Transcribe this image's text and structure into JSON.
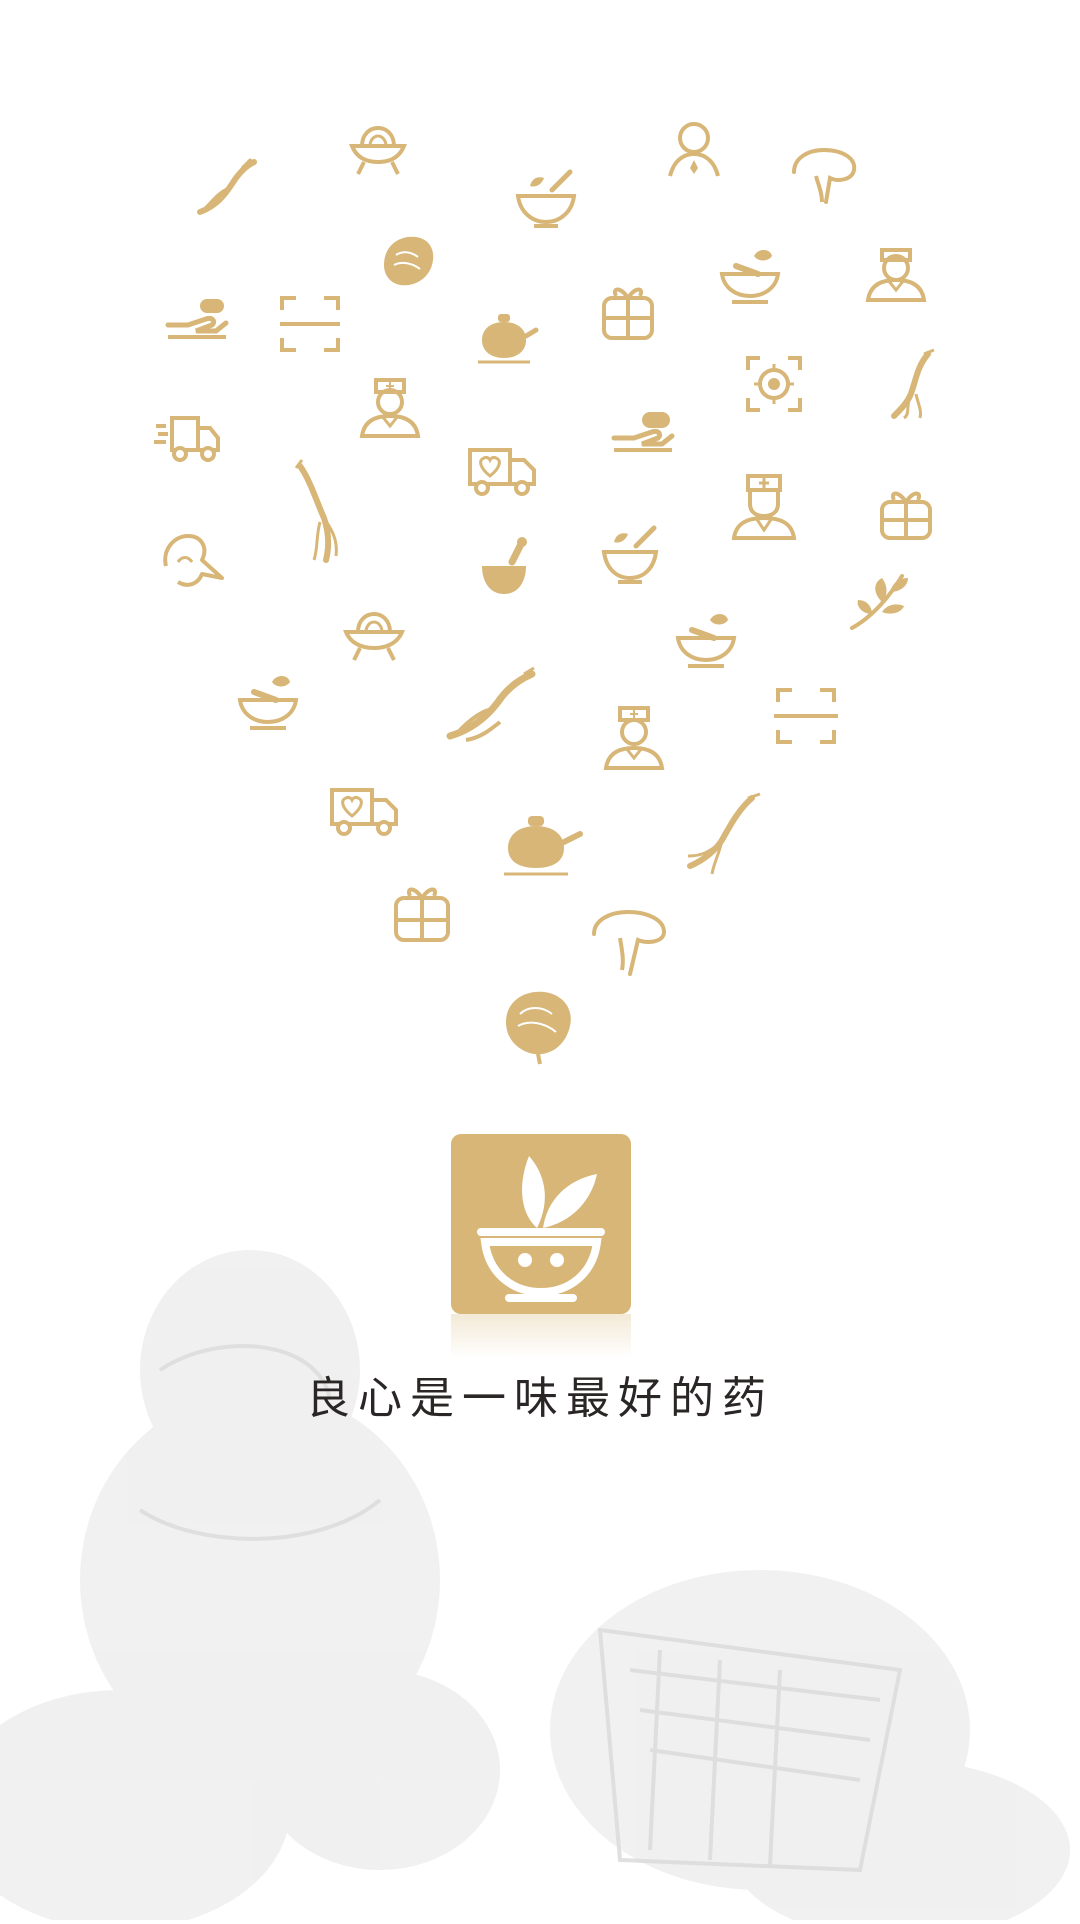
{
  "brand": {
    "slogan": "良心是一味最好的药",
    "accent_color": "#d7b677",
    "text_color": "#2b2626"
  },
  "icons": [
    "ginseng-icon",
    "medicine-scale-icon",
    "mortar-bowl-icon",
    "person-icon",
    "lingzhi-mushroom-icon",
    "mortar-pestle-icon",
    "doctor-icon",
    "lingzhi-icon",
    "hand-pill-icon",
    "scan-frame-icon",
    "teapot-icon",
    "gift-box-icon",
    "target-icon",
    "ginseng-icon",
    "delivery-truck-icon",
    "doctor-icon",
    "ambulance-icon",
    "hand-pill-icon",
    "ginseng-icon",
    "mushroom-icon",
    "mortar-pestle-icon",
    "mortar-bowl-icon",
    "nurse-icon",
    "gift-box-icon",
    "herb-leaf-icon",
    "medicine-scale-icon",
    "mortar-pestle-icon",
    "ginseng-icon",
    "mortar-bowl-icon",
    "doctor-icon",
    "scan-frame-icon",
    "ambulance-icon",
    "teapot-icon",
    "ginseng-icon",
    "gift-box-icon",
    "mushroom-icon",
    "lingzhi-icon"
  ]
}
